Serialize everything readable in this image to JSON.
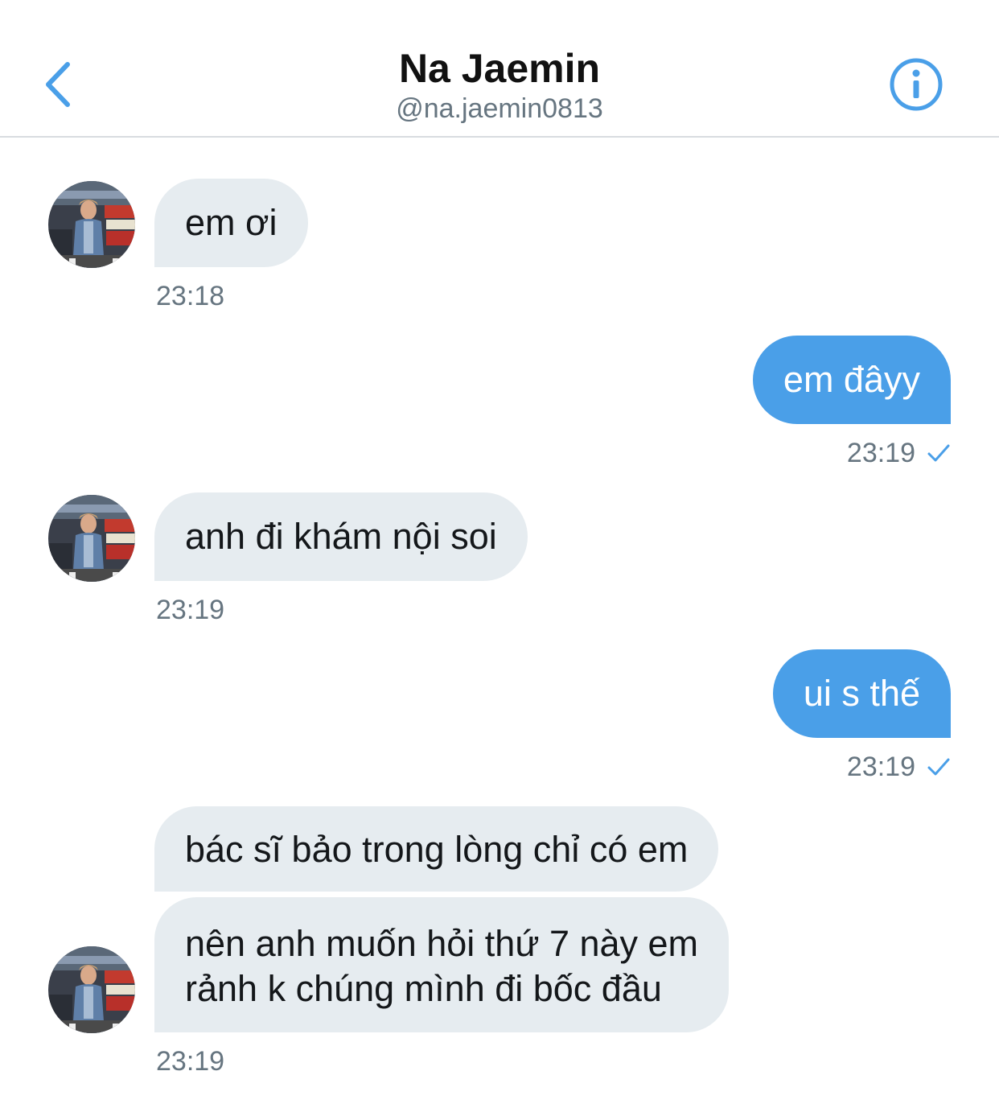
{
  "header": {
    "title": "Na Jaemin",
    "handle": "@na.jaemin0813"
  },
  "colors": {
    "accent": "#4a9fe8",
    "incoming_bubble": "#e6ecf0",
    "secondary_text": "#667580"
  },
  "icons": {
    "back": "chevron-left-icon",
    "info": "info-icon",
    "read": "checkmark-icon"
  },
  "messages": [
    {
      "direction": "incoming",
      "text": "em ơi",
      "time": "23:18"
    },
    {
      "direction": "outgoing",
      "text": "em đâyy",
      "time": "23:19"
    },
    {
      "direction": "incoming",
      "text": "anh đi khám nội soi",
      "time": "23:19"
    },
    {
      "direction": "outgoing",
      "text": "ui s thế",
      "time": "23:19"
    },
    {
      "direction": "incoming",
      "text": "bác sĩ bảo trong lòng chỉ có em"
    },
    {
      "direction": "incoming",
      "text_line1": "nên anh muốn hỏi thứ 7 này em",
      "text_line2": "rảnh k chúng mình đi bốc đầu",
      "time": "23:19"
    }
  ]
}
